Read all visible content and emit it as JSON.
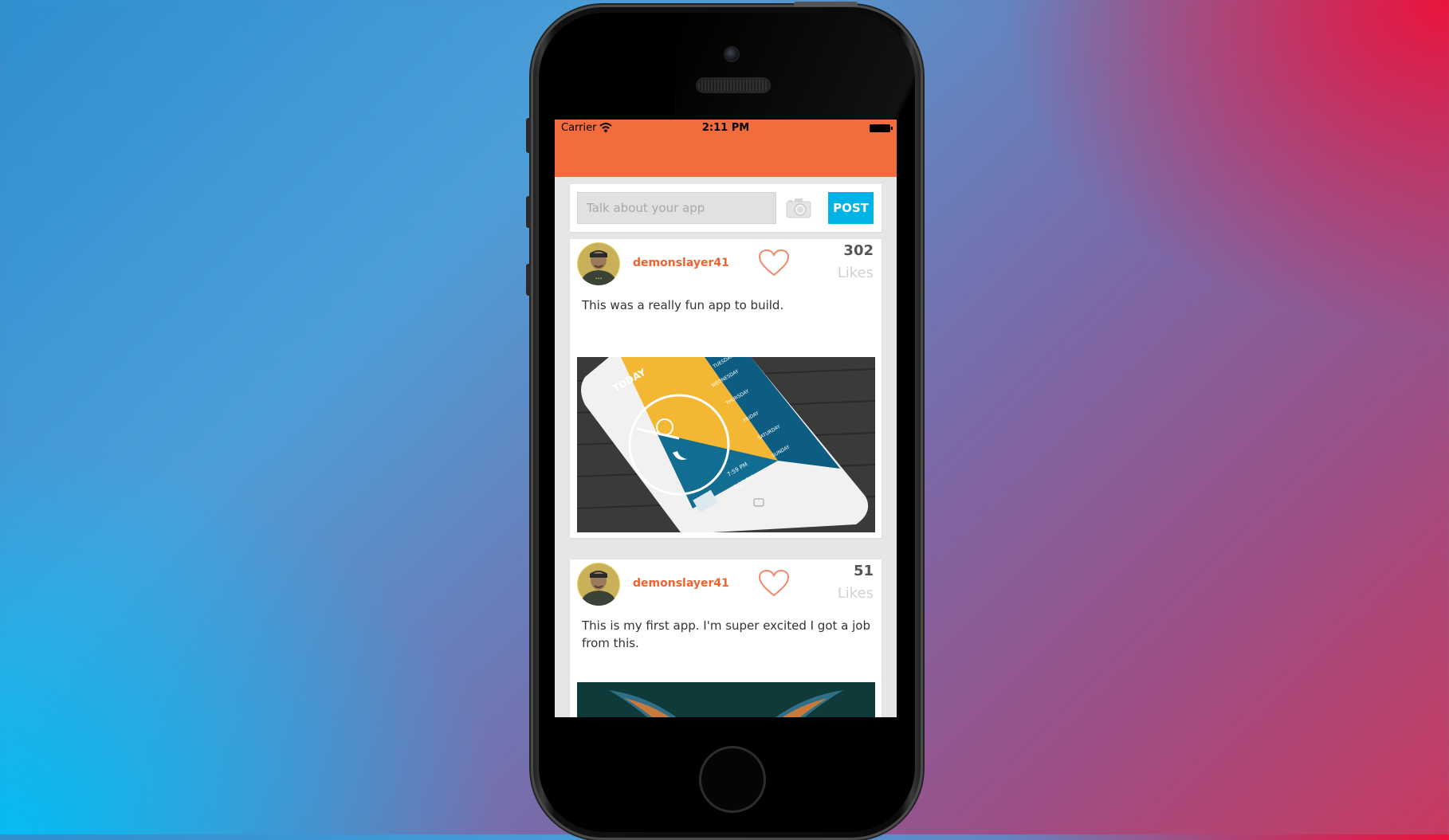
{
  "status_bar": {
    "carrier": "Carrier",
    "time": "2:11 PM"
  },
  "composer": {
    "placeholder": "Talk about your app",
    "post_label": "POST",
    "camera_icon": "camera-icon"
  },
  "posts": [
    {
      "username": "demonslayer41",
      "likes": "302",
      "likes_label": "Likes",
      "text": "This was a really fun app to build.",
      "image": "phone-weather-app-screenshot"
    },
    {
      "username": "demonslayer41",
      "likes": "51",
      "likes_label": "Likes",
      "text": "This is my first app. I'm super excited I got a job from this.",
      "image": "butterfly-wings-photo"
    }
  ],
  "colors": {
    "nav_bar": "#f26c3e",
    "username": "#f0622e",
    "post_button": "#00b3e6",
    "likes_label": "#d2d2d2"
  }
}
